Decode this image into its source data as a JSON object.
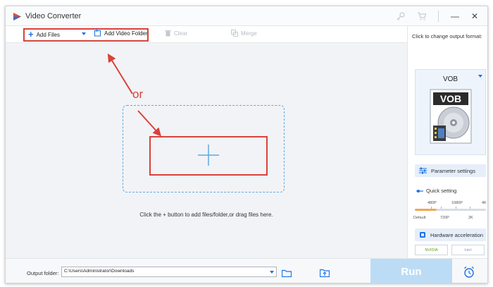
{
  "window": {
    "title": "Video Converter",
    "icons": [
      "app-logo-icon",
      "key-icon",
      "cart-icon"
    ],
    "controls": {
      "minimize": "—",
      "close": "✕"
    }
  },
  "toolbar": {
    "add_files": "Add Files",
    "add_video_folder": "Add Video Folder",
    "clear": "Clear",
    "merge": "Merge"
  },
  "annotation": {
    "or_text": "or",
    "highlight_color": "#d9423b"
  },
  "drop_area": {
    "hint": "Click the + button to add files/folder,or drag files here."
  },
  "right_panel": {
    "change_format_label": "Click to change output format:",
    "format": "VOB",
    "format_icon_text": "VOB",
    "parameter_settings": "Parameter settings",
    "quick_setting": "Quick setting",
    "slider_top_labels": [
      "480P",
      "1080P",
      "4K"
    ],
    "slider_bottom_labels": [
      "Default",
      "720P",
      "2K"
    ],
    "hardware_acceleration": "Hardware acceleration",
    "gpu_chips": [
      "NVIDIA",
      "Intel"
    ]
  },
  "bottom": {
    "output_folder_label": "Output folder:",
    "output_folder_value": "C:\\Users\\Administrator\\Downloads",
    "run": "Run"
  },
  "colors": {
    "accent": "#1a73e8",
    "run_button": "#bcdcf5",
    "dashed_border": "#5da9e4"
  }
}
